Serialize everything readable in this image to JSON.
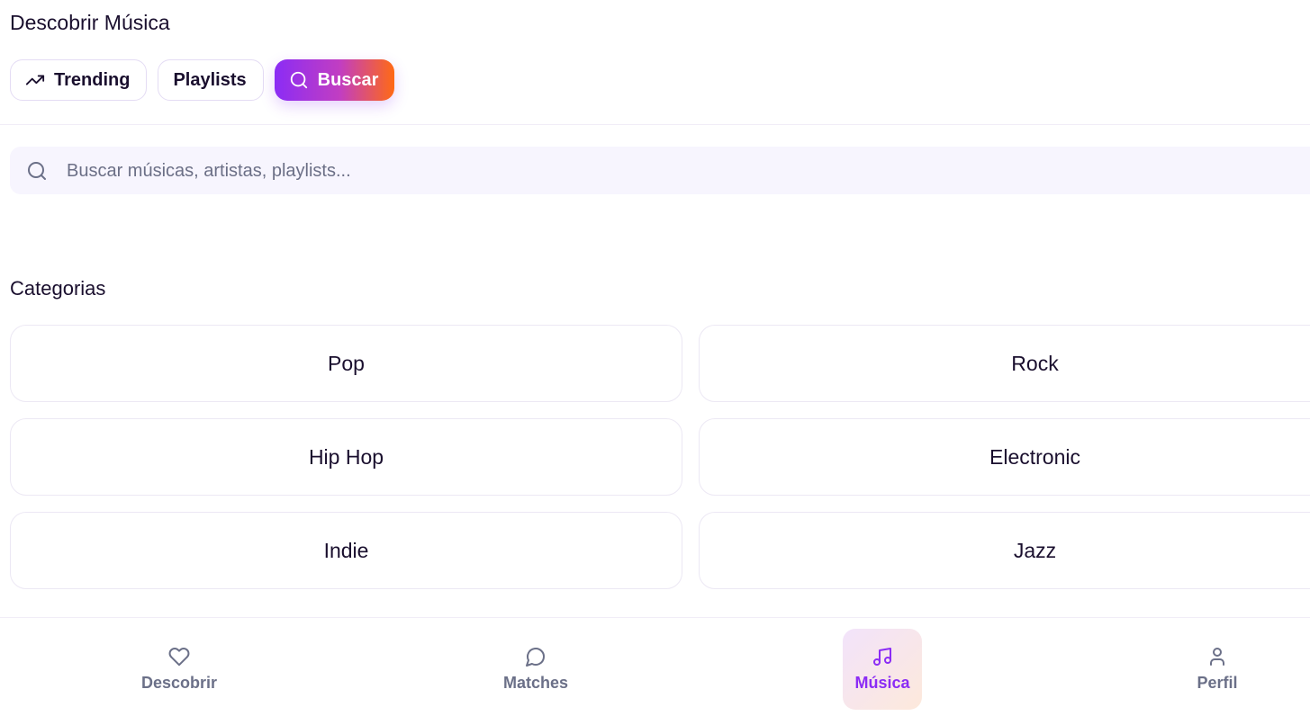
{
  "header": {
    "title": "Descobrir Música",
    "tabs": [
      {
        "label": "Trending",
        "icon": "trending-up-icon",
        "active": false
      },
      {
        "label": "Playlists",
        "active": false
      },
      {
        "label": "Buscar",
        "icon": "search-icon",
        "active": true
      }
    ]
  },
  "search": {
    "placeholder": "Buscar músicas, artistas, playlists...",
    "value": ""
  },
  "categories": {
    "title": "Categorias",
    "items": [
      "Pop",
      "Rock",
      "Hip Hop",
      "Electronic",
      "Indie",
      "Jazz"
    ]
  },
  "bottom_nav": {
    "items": [
      {
        "label": "Descobrir",
        "icon": "heart-icon",
        "active": false
      },
      {
        "label": "Matches",
        "icon": "message-circle-icon",
        "active": false
      },
      {
        "label": "Música",
        "icon": "music-note-icon",
        "active": true
      },
      {
        "label": "Perfil",
        "icon": "user-icon",
        "active": false
      }
    ]
  },
  "colors": {
    "accent": "#8b2cf5",
    "gradient_start": "#8b2cf5",
    "gradient_end": "#ff6a14",
    "muted_text": "#6b7088",
    "search_bg": "#f7f5fe"
  }
}
